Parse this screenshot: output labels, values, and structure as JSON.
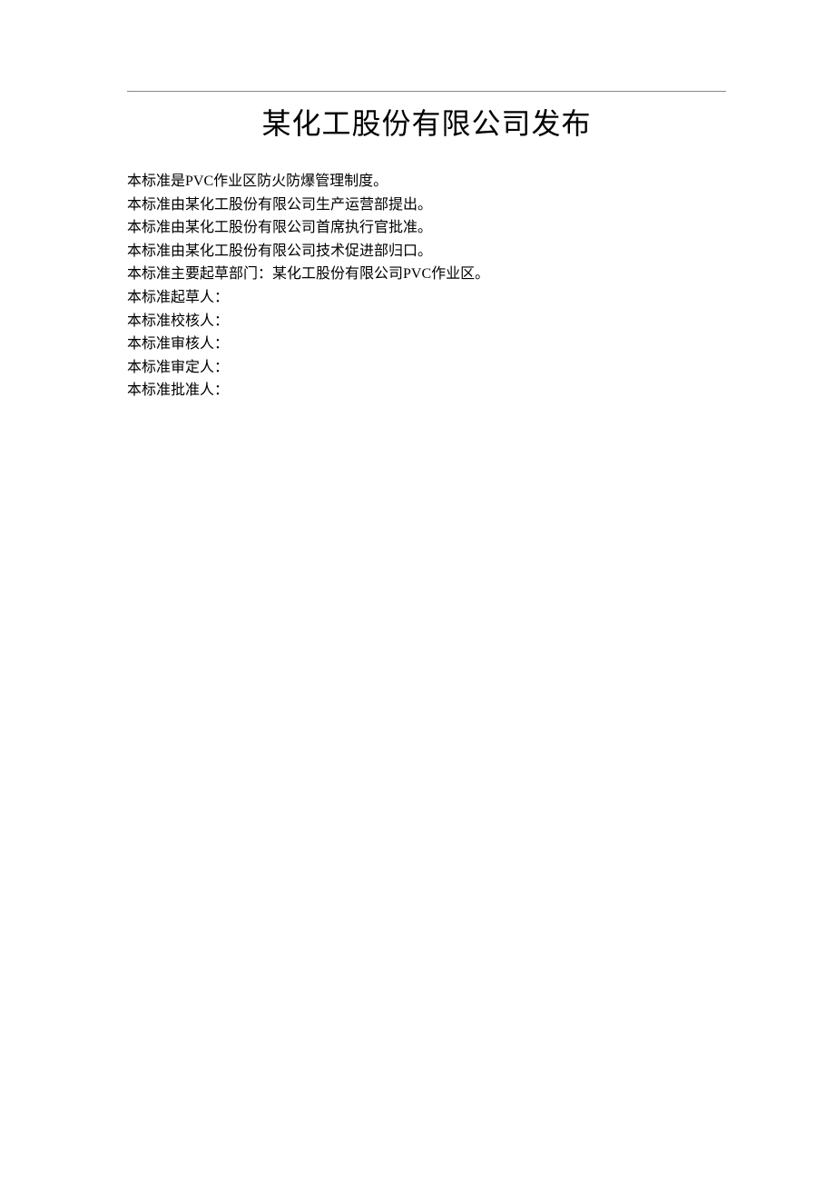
{
  "title": "某化工股份有限公司发布",
  "lines": [
    "本标准是PVC作业区防火防爆管理制度。",
    "本标准由某化工股份有限公司生产运营部提出。",
    "本标准由某化工股份有限公司首席执行官批准。",
    "本标准由某化工股份有限公司技术促进部归口。",
    "本标准主要起草部门：某化工股份有限公司PVC作业区。",
    "本标准起草人："
  ],
  "roles": [
    "本标准校核人：",
    "本标准审核人：",
    "本标准审定人：",
    "本标准批准人："
  ]
}
